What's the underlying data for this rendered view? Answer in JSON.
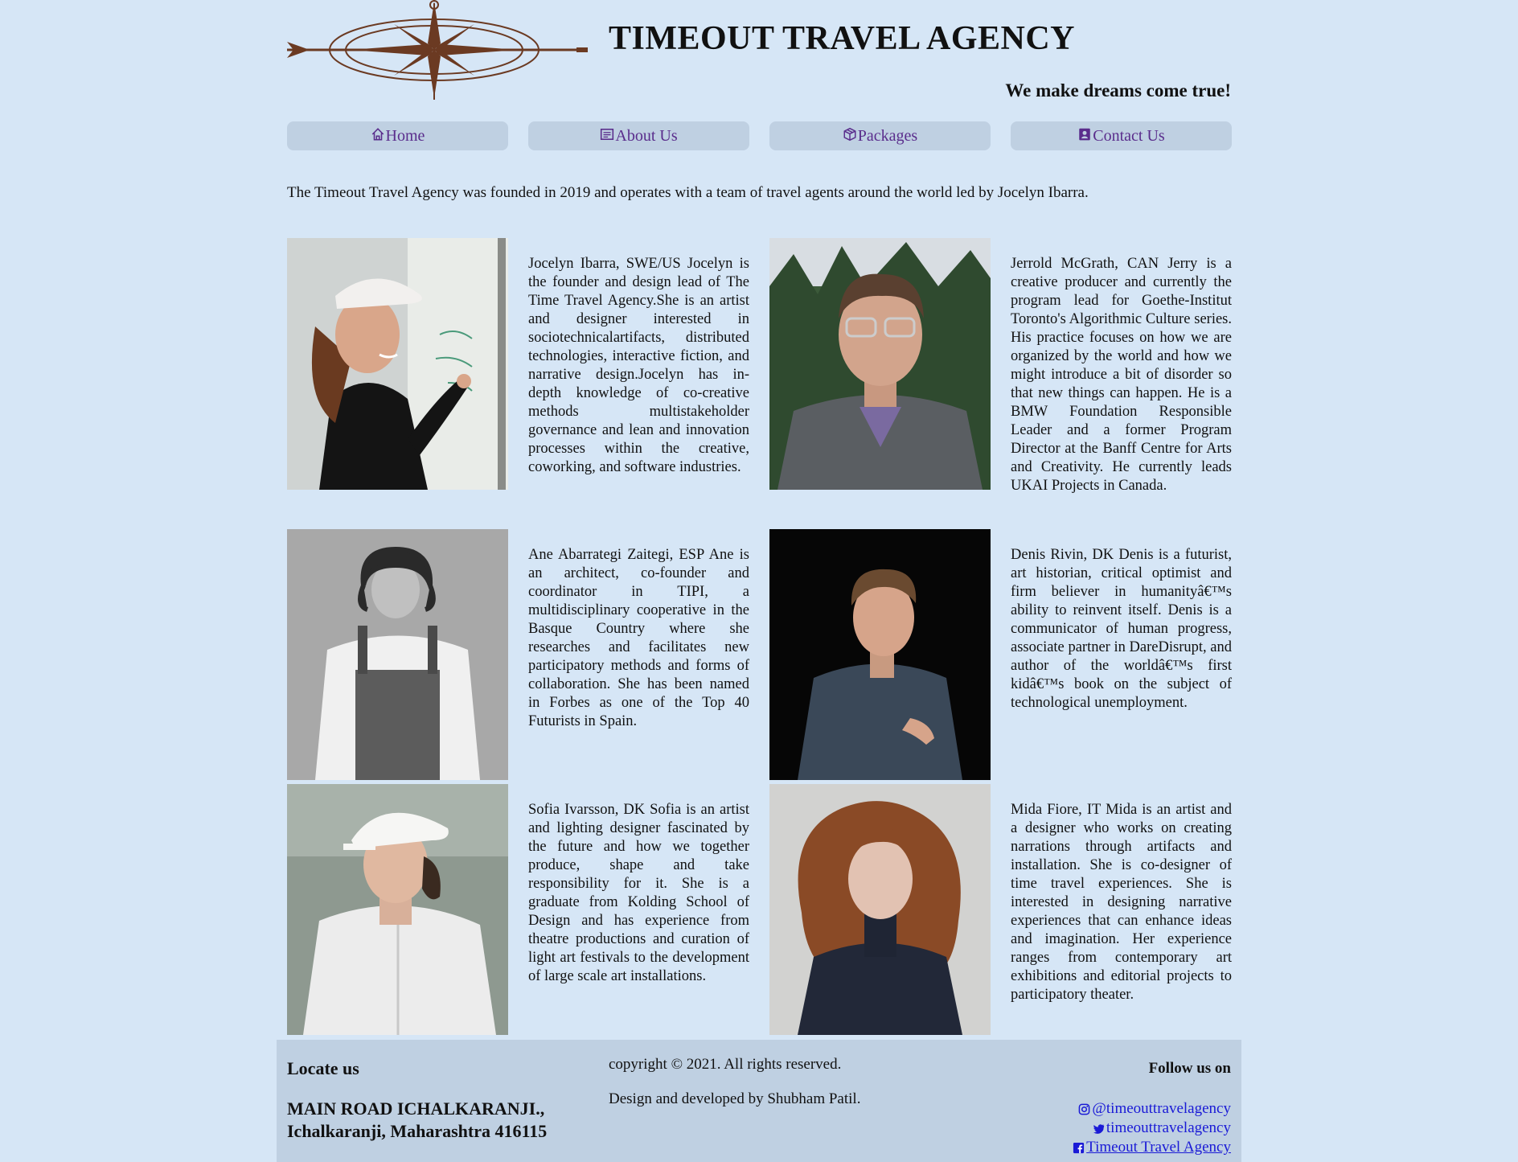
{
  "header": {
    "title": "TIMEOUT TRAVEL AGENCY",
    "tagline": "We make dreams come true!"
  },
  "nav": {
    "items": [
      {
        "label": "Home",
        "icon": "home-icon"
      },
      {
        "label": "About Us",
        "icon": "document-icon"
      },
      {
        "label": "Packages",
        "icon": "package-icon"
      },
      {
        "label": "Contact Us",
        "icon": "contact-card-icon"
      }
    ],
    "text_color": "#5a2d8c",
    "button_color": "#bfd0e2"
  },
  "intro": "The Timeout Travel Agency was founded in 2019 and operates with a team of travel agents around the world led by Jocelyn Ibarra.",
  "team": [
    {
      "bio": "Jocelyn Ibarra, SWE/US Jocelyn is the founder and design lead of The Time Travel Agency.She is an artist and designer interested in sociotechnicalartifacts, distributed technologies, interactive fiction, and narrative design.Jocelyn has in-depth knowledge of co-creative methods multistakeholder governance and lean and innovation processes within the creative, coworking, and software industries."
    },
    {
      "bio": "Jerrold McGrath, CAN Jerry is a creative producer and currently the program lead for Goethe-Institut Toronto's Algorithmic Culture series. His practice focuses on how we are organized by the world and how we might introduce a bit of disorder so that new things can happen. He is a BMW Foundation Responsible Leader and a former Program Director at the Banff Centre for Arts and Creativity. He currently leads UKAI Projects in Canada."
    },
    {
      "bio": "Ane Abarrategi Zaitegi, ESP Ane is an architect, co-founder and coordinator in TIPI, a multidisciplinary cooperative in the Basque Country where she researches and facilitates new participatory methods and forms of collaboration. She has been named in Forbes as one of the Top 40 Futurists in Spain."
    },
    {
      "bio": "Denis Rivin, DK Denis is a futurist, art historian, critical optimist and firm believer in humanityâ€™s ability to reinvent itself. Denis is a communicator of human progress, associate partner in DareDisrupt, and author of the worldâ€™s first kidâ€™s book on the subject of technological unemployment."
    },
    {
      "bio": "Sofia Ivarsson, DK Sofia is an artist and lighting designer fascinated by the future and how we together produce, shape and take responsibility for it. She is a graduate from Kolding School of Design and has experience from theatre productions and curation of light art festivals to the development of large scale art installations."
    },
    {
      "bio": "Mida Fiore, IT Mida is an artist and a designer who works on creating narrations through artifacts and installation. She is co-designer of time travel experiences. She is interested in designing narrative experiences that can enhance ideas and imagination. Her experience ranges from contemporary art exhibitions and editorial projects to participatory theater."
    }
  ],
  "footer": {
    "locate_heading": "Locate us",
    "address_line1": "MAIN ROAD ICHALKARANJI.,",
    "address_line2": "Ichalkaranji, Maharashtra 416115",
    "copyright": "copyright © 2021. All rights reserved.",
    "credit": "Design and developed by Shubham Patil.",
    "follow_heading": "Follow us on",
    "social": [
      {
        "label": "@timeouttravelagency",
        "icon": "instagram-icon"
      },
      {
        "label": "timeouttravelagency",
        "icon": "twitter-icon"
      },
      {
        "label": "Timeout Travel Agency",
        "icon": "facebook-icon"
      }
    ],
    "link_color": "#1a1ad6"
  }
}
